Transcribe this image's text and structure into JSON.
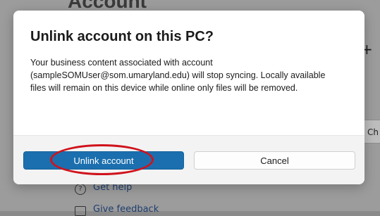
{
  "background": {
    "title": "Account",
    "plus_glyph": "+",
    "chip_text": "Ch",
    "help_icon_glyph": "?",
    "get_help": "Get help",
    "give_feedback": "Give feedback"
  },
  "dialog": {
    "title": "Unlink account on this PC?",
    "body": "Your business content associated with account (sampleSOMUser@som.umaryland.edu) will stop syncing. Locally available files will remain on this device while online only files will be removed.",
    "primary_button": "Unlink account",
    "secondary_button": "Cancel"
  },
  "colors": {
    "accent": "#1b6fae",
    "highlight": "#d0121b"
  }
}
